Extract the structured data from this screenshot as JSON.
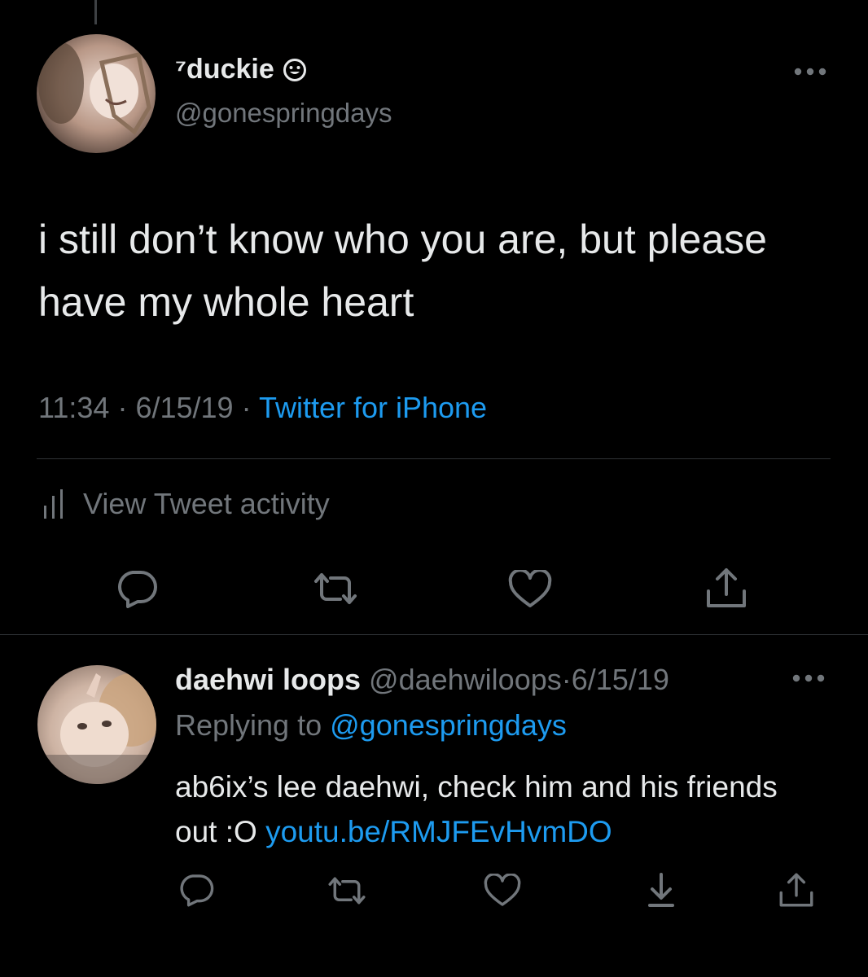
{
  "main_tweet": {
    "display_name": "⁷duckie",
    "name_emoji": "smiling-face-icon",
    "handle": "@gonespringdays",
    "text": "i still don’t know who you are, but please have my whole heart",
    "time": "11:34",
    "separator": "·",
    "date": "6/15/19",
    "source": "Twitter for iPhone",
    "activity_label": "View Tweet activity",
    "actions": [
      "reply-icon",
      "retweet-icon",
      "like-icon",
      "share-icon"
    ]
  },
  "reply_tweet": {
    "display_name": "daehwi loops",
    "handle": "@daehwiloops",
    "separator": "·",
    "date": "6/15/19",
    "replying_prefix": "Replying to",
    "replying_to": "@gonespringdays",
    "text": "ab6ix’s lee daehwi, check him and his friends out :O",
    "link": "youtu.be/RMJFEvHvmDO",
    "actions": [
      "reply-icon",
      "retweet-icon",
      "like-icon",
      "bookmark-download-icon",
      "share-icon"
    ]
  },
  "colors": {
    "background": "#000000",
    "primary_text": "#e7e9ea",
    "secondary_text": "#71767b",
    "accent": "#1d9bf0",
    "divider": "#2f3336"
  }
}
